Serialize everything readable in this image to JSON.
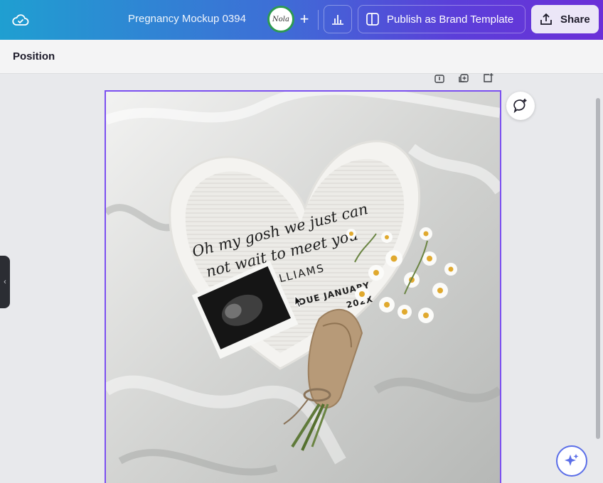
{
  "header": {
    "doc_title": "Pregnancy Mockup 0394",
    "avatar_text": "Nola",
    "add_label": "+",
    "publish_label": "Publish as Brand Template",
    "share_label": "Share"
  },
  "toolbar": {
    "position_label": "Position"
  },
  "design": {
    "script_line_1": "Oh my gosh we just can",
    "script_line_2": "not wait to meet you",
    "name_line": "BABY WILLIAMS",
    "due_line_1": "DUE JANUARY",
    "due_line_2": "202X"
  },
  "icons": {
    "cloud": "cloud-sync-icon",
    "insights": "bar-chart-icon",
    "publish": "brand-template-icon",
    "share": "upload-icon",
    "comment": "add-comment-icon",
    "magic": "sparkle-icon",
    "collapse": "chevron-left-icon"
  },
  "colors": {
    "accent": "#7b4ff0",
    "avatar_ring": "#2e9a52",
    "share_bg": "#ebe6f7"
  }
}
